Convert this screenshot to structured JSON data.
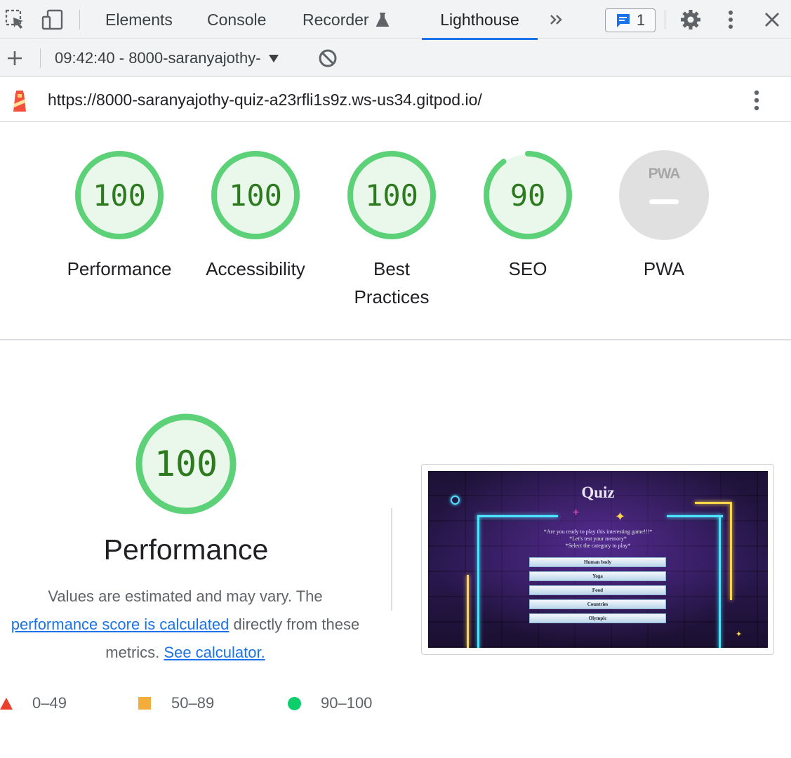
{
  "devtools": {
    "tabs": [
      {
        "label": "Elements",
        "active": false
      },
      {
        "label": "Console",
        "active": false
      },
      {
        "label": "Recorder",
        "active": false
      },
      {
        "label": "Lighthouse",
        "active": true
      }
    ],
    "issues_count": "1"
  },
  "toolbar": {
    "report_select": "09:42:40 - 8000-saranyajothy-"
  },
  "report": {
    "url": "https://8000-saranyajothy-quiz-a23rfli1s9z.ws-us34.gitpod.io/"
  },
  "gauges": [
    {
      "label": "Performance",
      "score": "100",
      "fraction": 1.0
    },
    {
      "label": "Accessibility",
      "score": "100",
      "fraction": 1.0
    },
    {
      "label": "Best Practices",
      "score": "100",
      "fraction": 1.0
    },
    {
      "label": "SEO",
      "score": "90",
      "fraction": 0.9
    },
    {
      "label": "PWA",
      "score": "",
      "badge_text": "PWA"
    }
  ],
  "performance": {
    "score": "100",
    "fraction": 1.0,
    "title": "Performance",
    "desc_before": "Values are estimated and may vary. The ",
    "desc_link1": "performance score is calculated",
    "desc_middle": " directly from these metrics. ",
    "desc_link2": "See calculator."
  },
  "legend": [
    {
      "range": "0–49",
      "color": "#eb3f2a",
      "shape": "triangle"
    },
    {
      "range": "50–89",
      "color": "#f4ac3b",
      "shape": "square"
    },
    {
      "range": "90–100",
      "color": "#0cce6b",
      "shape": "circle"
    }
  ],
  "screenshot": {
    "title": "Quiz",
    "intro_lines": [
      "*Are you ready to play this interesting game!!!*",
      "*Let's test your memory*",
      "*Select the category to play*"
    ],
    "categories": [
      "Human body",
      "Yoga",
      "Food",
      "Countries",
      "Olympic"
    ]
  },
  "colors": {
    "pass": "#0cce6b",
    "pass_ring": "#5dd177",
    "pass_fill": "#eaf8ec",
    "pass_text": "#2d7a1f",
    "accent": "#1a73e8"
  }
}
